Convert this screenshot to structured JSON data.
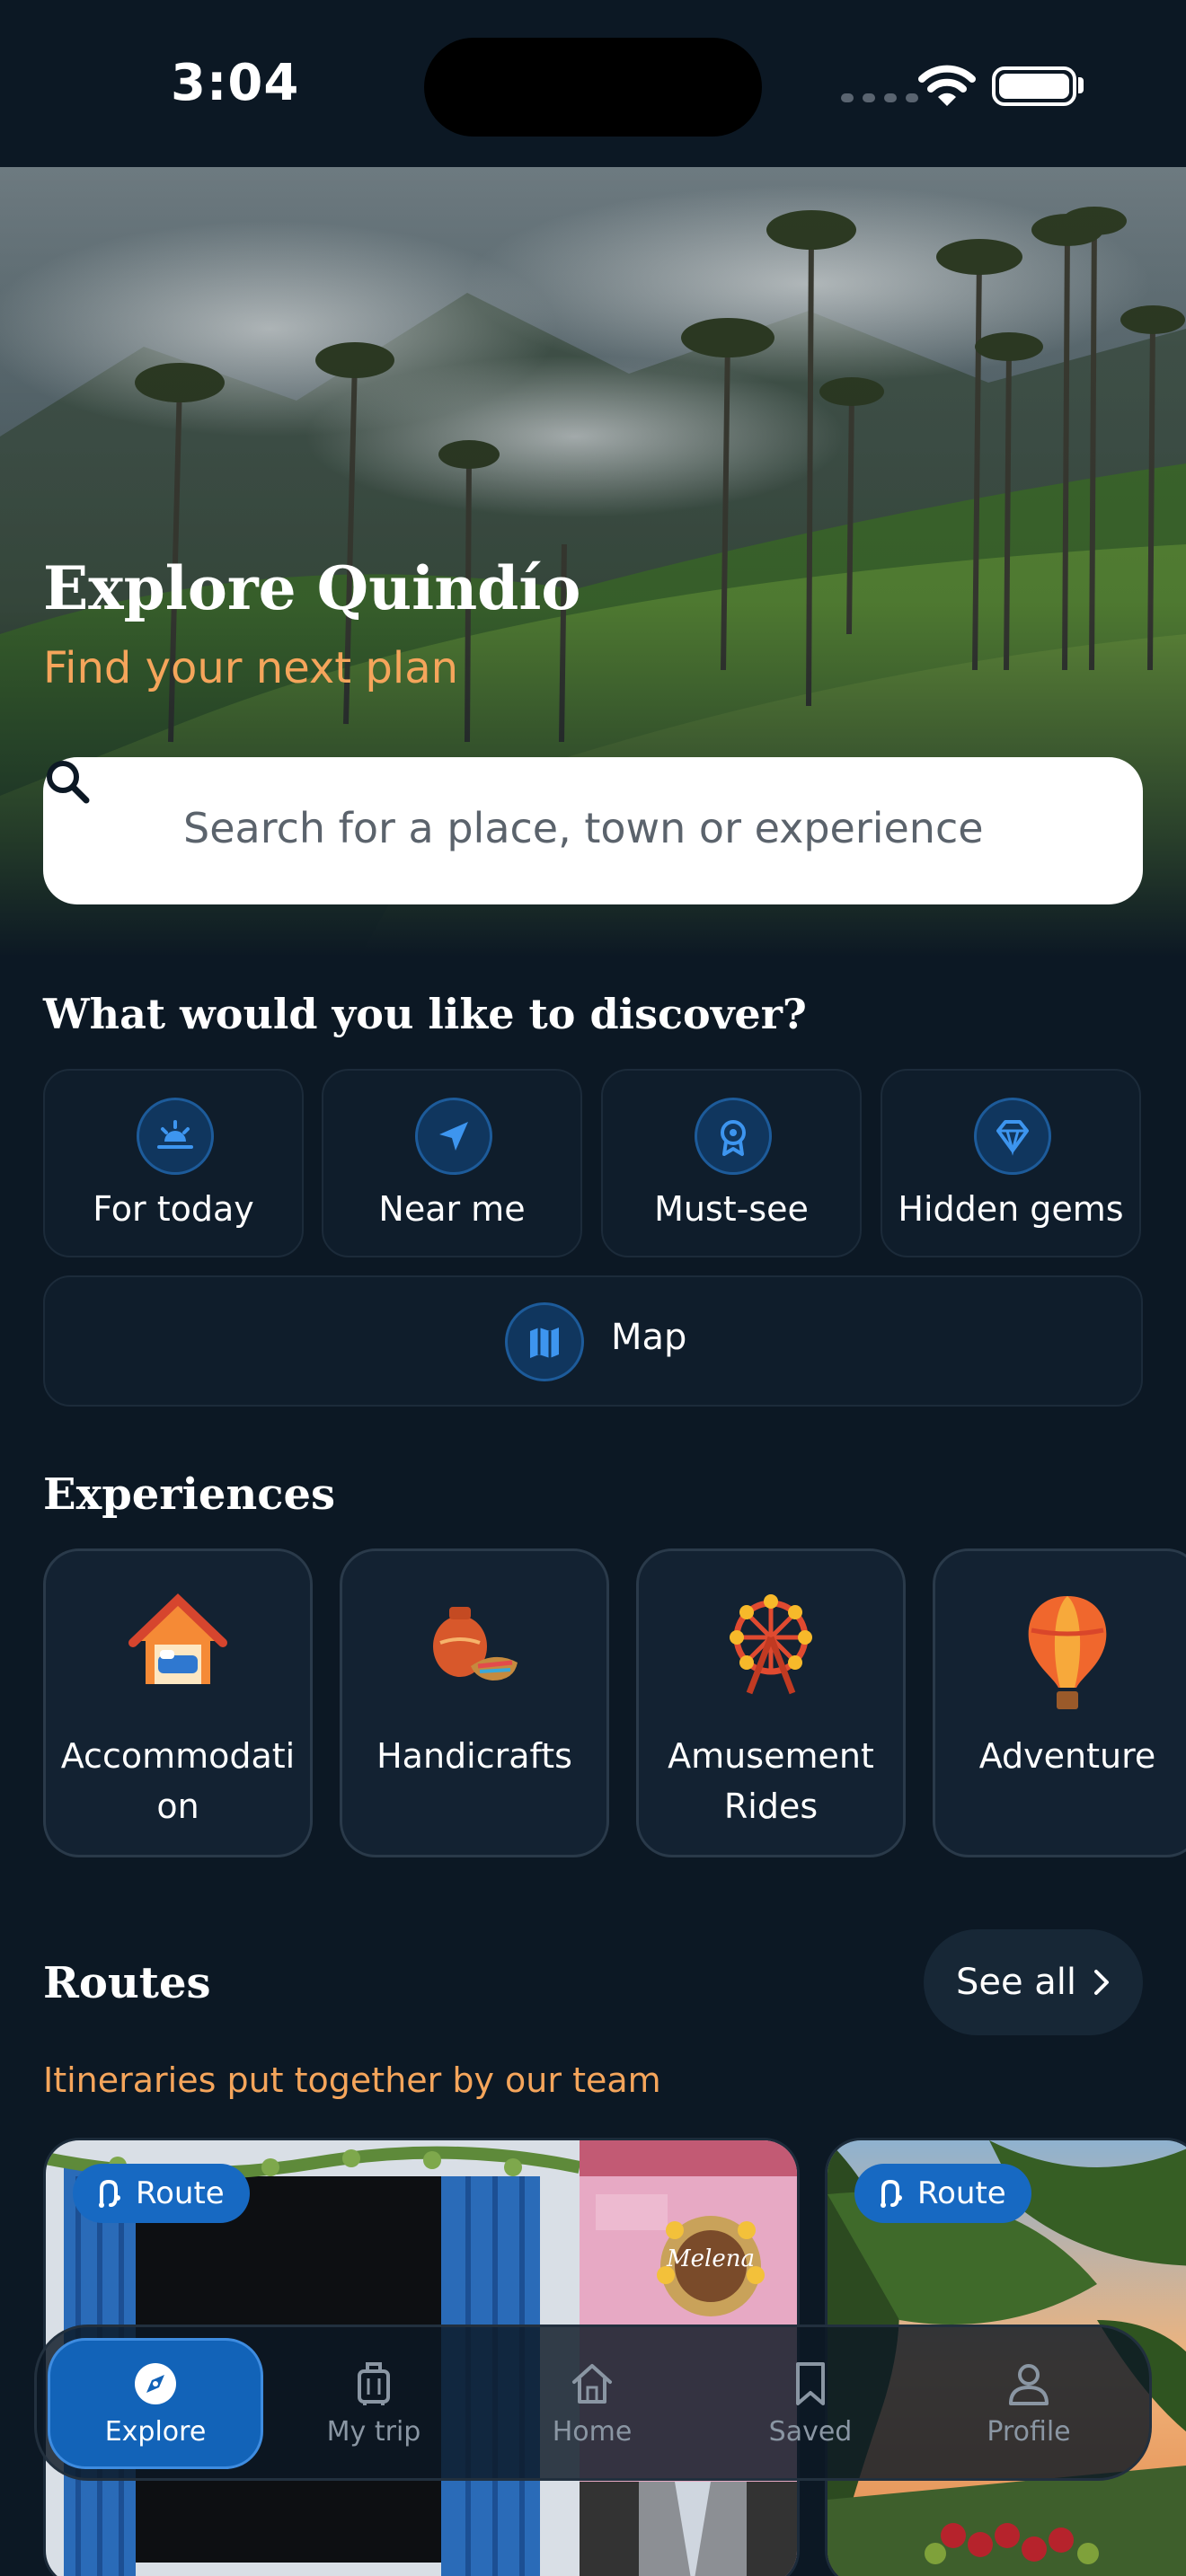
{
  "status_bar": {
    "time": "3:04"
  },
  "hero": {
    "title": "Explore Quindío",
    "subtitle": "Find your next plan",
    "search_placeholder": "Search for a place, town or experience"
  },
  "discover": {
    "title": "What would you like to discover?",
    "items": [
      {
        "label": "For today",
        "icon": "sunrise-icon"
      },
      {
        "label": "Near me",
        "icon": "navigation-arrow-icon"
      },
      {
        "label": "Must-see",
        "icon": "award-badge-icon"
      },
      {
        "label": "Hidden gems",
        "icon": "diamond-icon"
      }
    ],
    "map": {
      "label": "Map",
      "icon": "map-icon"
    }
  },
  "experiences": {
    "title": "Experiences",
    "items": [
      {
        "label": "Accommodati on",
        "icon": "house-bed-icon"
      },
      {
        "label": "Handicrafts",
        "icon": "pottery-icon"
      },
      {
        "label": "Amusement Rides",
        "icon": "ferris-wheel-icon"
      },
      {
        "label": "Adventure",
        "icon": "hot-air-balloon-icon"
      }
    ]
  },
  "routes": {
    "title": "Routes",
    "see_all": "See all",
    "subtitle": "Itineraries put together by our team",
    "cards": [
      {
        "badge": "Route",
        "sign": "Melena"
      },
      {
        "badge": "Route"
      }
    ]
  },
  "bottom_nav": {
    "items": [
      {
        "label": "Explore",
        "icon": "compass-icon",
        "active": true
      },
      {
        "label": "My trip",
        "icon": "luggage-icon",
        "active": false
      },
      {
        "label": "Home",
        "icon": "home-icon",
        "active": false
      },
      {
        "label": "Saved",
        "icon": "bookmark-icon",
        "active": false
      },
      {
        "label": "Profile",
        "icon": "person-icon",
        "active": false
      }
    ]
  },
  "colors": {
    "background": "#0c1824",
    "accent_orange": "#f5a55b",
    "accent_blue": "#1263b8",
    "card_border": "#1c2b3a"
  }
}
